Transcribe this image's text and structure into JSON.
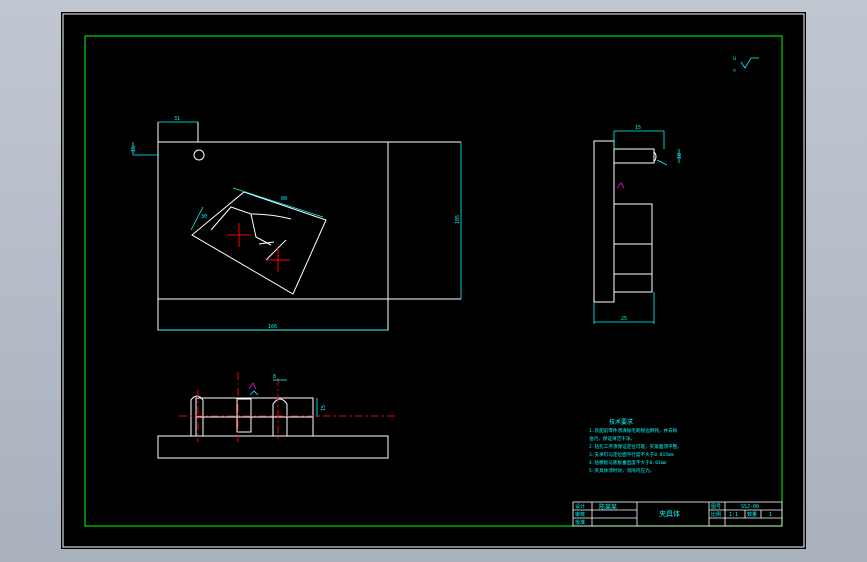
{
  "app": {
    "window_title": "",
    "colors": {
      "background": "#000000",
      "frame": "#ffffff",
      "inner_frame": "#00ff00",
      "geometry": "#ffffff",
      "dimension": "#00ffff",
      "center_line": "#ff0000",
      "hatch": "#ff00ff",
      "title_text": "#00ffff"
    }
  },
  "drawing": {
    "dimensions": {
      "top_left_width": "31",
      "top_left_height": "15",
      "plate_width": "166",
      "plate_height": "105",
      "block_width": "80",
      "block_height": "30",
      "side_top_width": "15",
      "side_small": "10",
      "side_bottom_width": "25",
      "front_pin": "8",
      "front_height": "15"
    },
    "tech_requirements": {
      "title": "技术要求",
      "lines": [
        "1.装配前零件须清除毛刺锐边倒钝，并去除",
        "  油污，保证清洁干净。",
        "2.钻孔工序须保证定位可靠，夹紧面须平整。",
        "3.支承钉与定位面平行度不大于0.015mm",
        "4.钻模板与底板垂直度不大于0.01mm",
        "5.夹具体须时效，消除内应力。"
      ]
    },
    "title_block": {
      "label_design": "设计",
      "label_check": "审核",
      "label_approve": "批准",
      "designer": "陈某某",
      "part_name": "夹具体",
      "label_drawing_no": "图号",
      "drawing_no": "SSJ-00",
      "label_scale": "比例",
      "scale": "1:1",
      "label_qty": "数量",
      "qty": "1"
    },
    "corner_mark": "ü"
  }
}
